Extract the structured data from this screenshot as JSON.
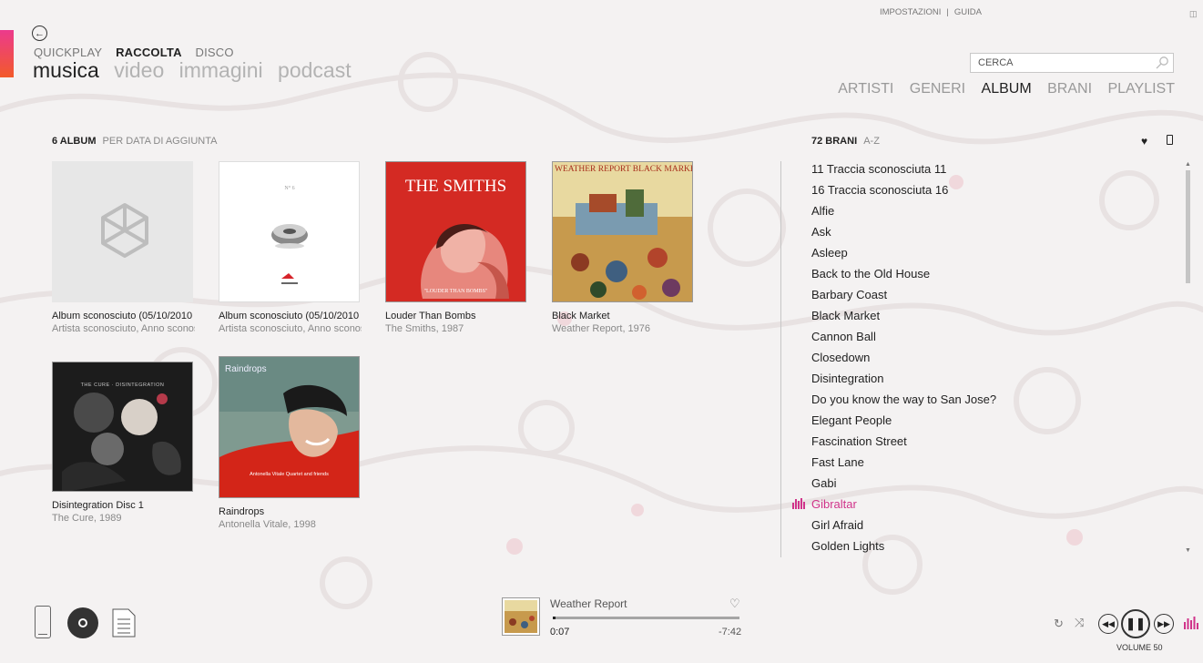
{
  "header": {
    "subnav": [
      "QUICKPLAY",
      "RACCOLTA",
      "DISCO"
    ],
    "subnav_active": 1,
    "mainnav": [
      "musica",
      "video",
      "immagini",
      "podcast"
    ],
    "mainnav_active": 0,
    "toplinks": {
      "settings": "IMPOSTAZIONI",
      "separator": "|",
      "help": "GUIDA"
    },
    "search_placeholder": "CERCA",
    "viewnav": [
      "ARTISTI",
      "GENERI",
      "ALBUM",
      "BRANI",
      "PLAYLIST"
    ],
    "viewnav_active": 2
  },
  "albums_section": {
    "count_label": "6 ALBUM",
    "sort_label": "PER DATA DI AGGIUNTA"
  },
  "albums": [
    {
      "title": "Album sconosciuto (05/10/2010",
      "subtitle": "Artista sconosciuto, Anno sconosciuto",
      "art": "zune-placeholder"
    },
    {
      "title": "Album sconosciuto (05/10/2010",
      "subtitle": "Artista sconosciuto, Anno sconosciuto",
      "art": "focal-speaker"
    },
    {
      "title": "Louder Than Bombs",
      "subtitle": "The Smiths, 1987",
      "art": "smiths",
      "art_text": "THE SMITHS",
      "art_caption": "\"LOUDER THAN BOMBS\""
    },
    {
      "title": "Black Market",
      "subtitle": "Weather Report, 1976",
      "art": "weather-report",
      "art_text": "WEATHER REPORT BLACK MARKET"
    },
    {
      "title": "Disintegration Disc 1",
      "subtitle": "The Cure, 1989",
      "art": "cure",
      "art_text": "THE CURE · DISINTEGRATION"
    },
    {
      "title": "Raindrops",
      "subtitle": "Antonella Vitale, 1998",
      "art": "raindrops",
      "art_text": "Raindrops",
      "art_caption": "Antonella Vitale Quartet and friends"
    }
  ],
  "tracks_section": {
    "count_label": "72 BRANI",
    "sort_label": "A-Z"
  },
  "tracks": [
    {
      "title": "11 Traccia sconosciuta 11",
      "playing": false
    },
    {
      "title": "16 Traccia sconosciuta 16",
      "playing": false
    },
    {
      "title": "Alfie",
      "playing": false
    },
    {
      "title": "Ask",
      "playing": false
    },
    {
      "title": "Asleep",
      "playing": false
    },
    {
      "title": "Back to the Old House",
      "playing": false
    },
    {
      "title": "Barbary Coast",
      "playing": false
    },
    {
      "title": "Black Market",
      "playing": false
    },
    {
      "title": "Cannon Ball",
      "playing": false
    },
    {
      "title": "Closedown",
      "playing": false
    },
    {
      "title": "Disintegration",
      "playing": false
    },
    {
      "title": "Do you know the way to San Jose?",
      "playing": false
    },
    {
      "title": "Elegant People",
      "playing": false
    },
    {
      "title": "Fascination Street",
      "playing": false
    },
    {
      "title": "Fast Lane",
      "playing": false
    },
    {
      "title": "Gabi",
      "playing": false
    },
    {
      "title": "Gibraltar",
      "playing": true
    },
    {
      "title": "Girl Afraid",
      "playing": false
    },
    {
      "title": "Golden Lights",
      "playing": false
    }
  ],
  "now_playing": {
    "artist": "Weather Report",
    "elapsed": "0:07",
    "remaining": "-7:42",
    "progress_fraction": 0.016
  },
  "player": {
    "volume_label": "VOLUME 50"
  },
  "colors": {
    "accent_pink": "#d0338a",
    "accent_gradient_top": "#ec3a8d",
    "accent_gradient_bottom": "#f25a2a"
  }
}
